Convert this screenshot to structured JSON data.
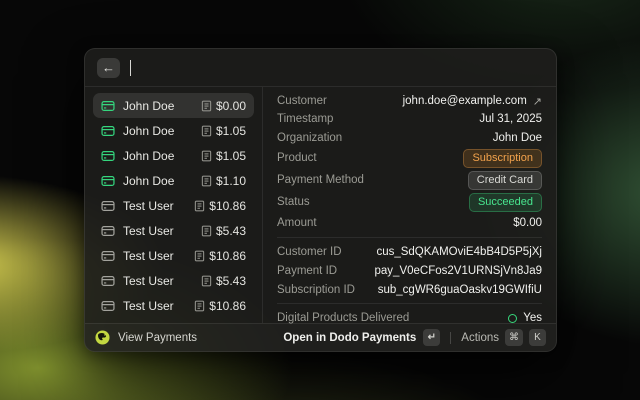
{
  "header": {
    "back_label": "←",
    "search_value": ""
  },
  "list": {
    "items": [
      {
        "name": "John Doe",
        "amount": "$0.00",
        "icon": "green",
        "selected": true
      },
      {
        "name": "John Doe",
        "amount": "$1.05",
        "icon": "green",
        "selected": false
      },
      {
        "name": "John Doe",
        "amount": "$1.05",
        "icon": "green",
        "selected": false
      },
      {
        "name": "John Doe",
        "amount": "$1.10",
        "icon": "green",
        "selected": false
      },
      {
        "name": "Test User",
        "amount": "$10.86",
        "icon": "gray",
        "selected": false
      },
      {
        "name": "Test User",
        "amount": "$5.43",
        "icon": "gray",
        "selected": false
      },
      {
        "name": "Test User",
        "amount": "$10.86",
        "icon": "gray",
        "selected": false
      },
      {
        "name": "Test User",
        "amount": "$5.43",
        "icon": "gray",
        "selected": false
      },
      {
        "name": "Test User",
        "amount": "$10.86",
        "icon": "gray",
        "selected": false
      }
    ]
  },
  "details": {
    "rows": [
      {
        "label": "Customer",
        "value": "john.doe@example.com",
        "type": "link",
        "h": "t18",
        "arrow": "↗"
      },
      {
        "label": "Timestamp",
        "value": "Jul 31, 2025",
        "type": "text",
        "h": "t18"
      },
      {
        "label": "Organization",
        "value": "John Doe",
        "type": "text",
        "h": "t19"
      },
      {
        "label": "Product",
        "value": "Subscription",
        "type": "badge",
        "badge": "badge-orange",
        "h": "t22"
      },
      {
        "label": "Payment Method",
        "value": "Credit Card",
        "type": "badge",
        "badge": "badge-gray",
        "h": "t22"
      },
      {
        "label": "Status",
        "value": "Succeeded",
        "type": "badge",
        "badge": "badge-green",
        "h": "t22"
      },
      {
        "label": "Amount",
        "value": "$0.00",
        "type": "text",
        "h": "t20",
        "divider_after": true
      },
      {
        "label": "Customer ID",
        "value": "cus_SdQKAMOviE4bB4D5P5jXj",
        "type": "text",
        "h": "t19"
      },
      {
        "label": "Payment ID",
        "value": "pay_V0eCFos2V1URNSjVn8Ja9",
        "type": "text",
        "h": "t19"
      },
      {
        "label": "Subscription ID",
        "value": "sub_cgWR6guaOaskv19GWIfiU",
        "type": "text",
        "h": "t19",
        "divider_after": true
      },
      {
        "label": "Digital Products Delivered",
        "value": "Yes",
        "type": "yes",
        "h": "t20"
      }
    ]
  },
  "footer": {
    "app_label": "View Payments",
    "primary_action": "Open in Dodo Payments",
    "primary_key": "↵",
    "actions_label": "Actions",
    "actions_keys": [
      "⌘",
      "K"
    ]
  },
  "colors": {
    "accent_green": "#35d67e",
    "badge_orange_text": "#f2a24c",
    "badge_green_text": "#48e58e",
    "logo_yellow_green": "#c3d841"
  }
}
